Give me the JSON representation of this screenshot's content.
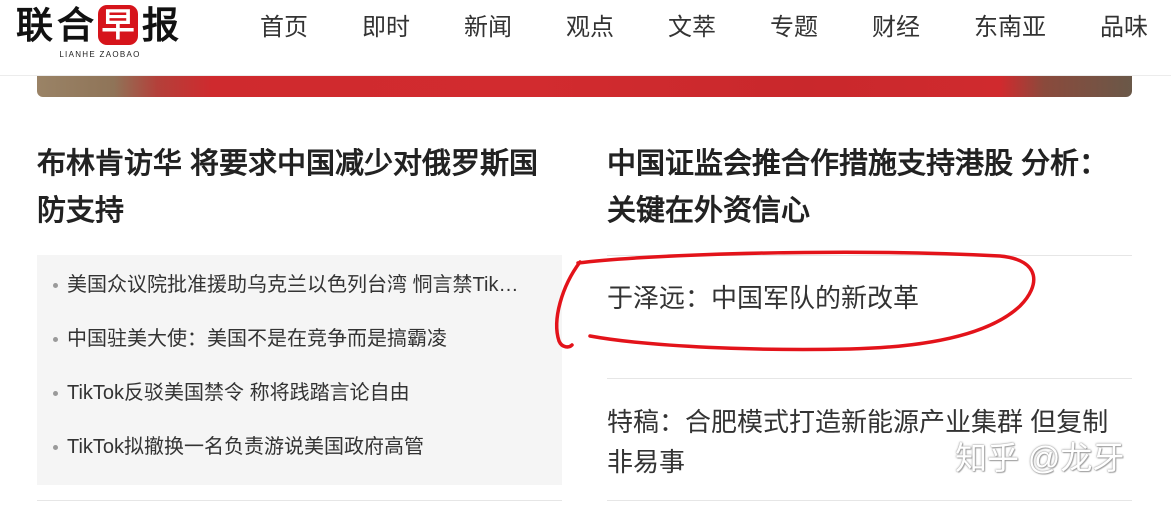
{
  "header": {
    "logo": {
      "chars": [
        "联",
        "合",
        "早",
        "报"
      ],
      "subtitle": "LIANHE ZAOBAO"
    },
    "nav": [
      {
        "label": "首页"
      },
      {
        "label": "即时"
      },
      {
        "label": "新闻"
      },
      {
        "label": "观点"
      },
      {
        "label": "文萃"
      },
      {
        "label": "专题"
      },
      {
        "label": "财经"
      },
      {
        "label": "东南亚"
      },
      {
        "label": "品味"
      }
    ]
  },
  "left_column": {
    "headline": "布林肯访华 将要求中国减少对俄罗斯国防支持",
    "related": [
      "美国众议院批准援助乌克兰以色列台湾 恫言禁Tik…",
      "中国驻美大使：美国不是在竞争而是搞霸凌",
      "TikTok反驳美国禁令 称将践踏言论自由",
      "TikTok拟撤换一名负责游说美国政府高管"
    ]
  },
  "right_column": {
    "headline": "中国证监会推合作措施支持港股 分析：关键在外资信心",
    "stories": [
      {
        "title": "于泽远：中国军队的新改革",
        "circled": true
      },
      {
        "title": "特稿：合肥模式打造新能源产业集群 但复制非易事",
        "circled": false
      }
    ]
  },
  "watermark": "知乎 @龙牙",
  "colors": {
    "brand_red": "#d6141b",
    "circle_annotation": "#e3131a",
    "headline_text": "#222222",
    "body_text": "#333333",
    "related_box_bg": "#f5f5f5"
  }
}
